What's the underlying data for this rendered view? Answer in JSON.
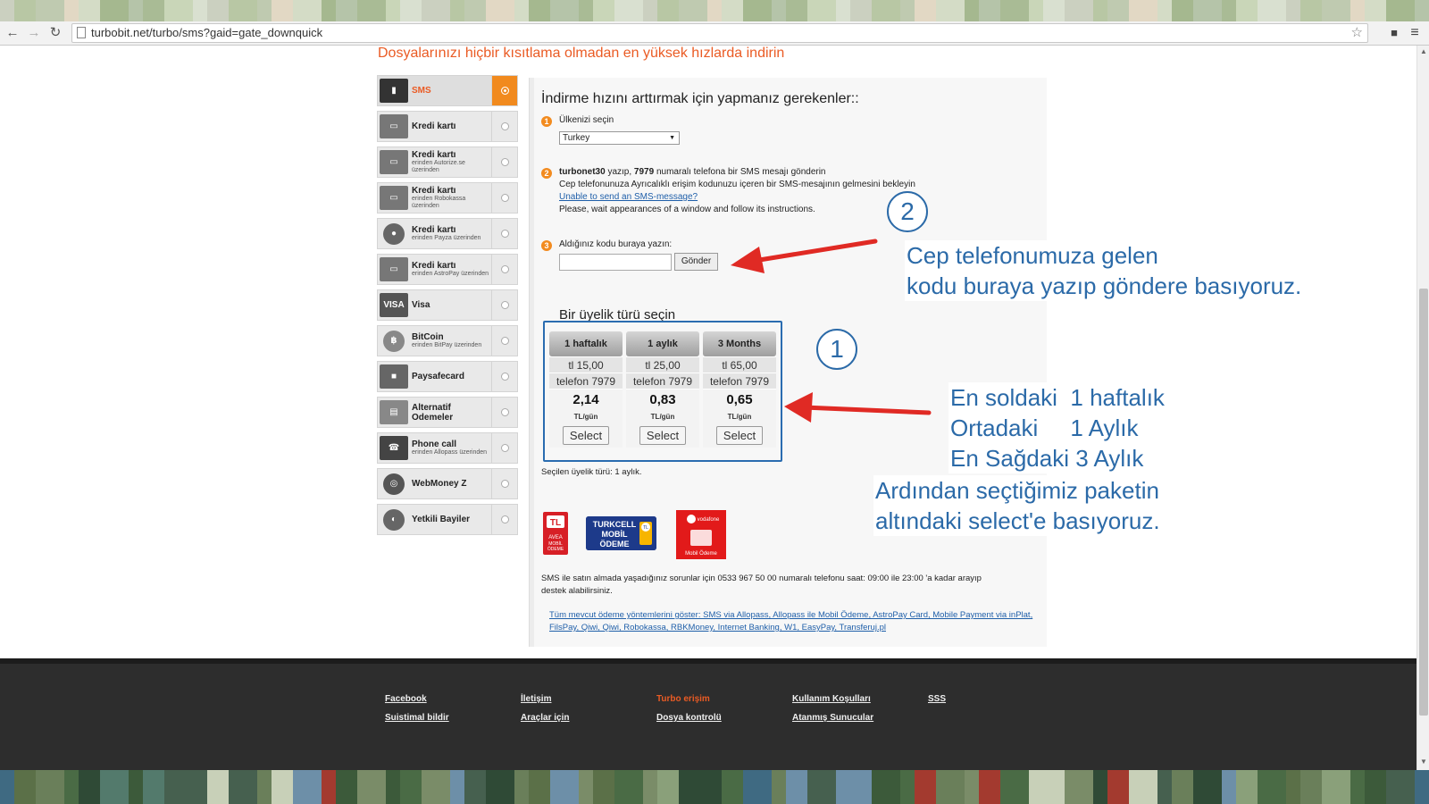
{
  "browser": {
    "url": "turbobit.net/turbo/sms?gaid=gate_downquick",
    "back": "←",
    "forward": "→",
    "reload": "↻",
    "star": "☆",
    "menu": "≡"
  },
  "headline": "Dosyalarınızı hiçbir kısıtlama olmadan en yüksek hızlarda indirin",
  "sidebar": {
    "items": [
      {
        "label": "SMS",
        "sub": "",
        "icon": "phone-icon",
        "active": true
      },
      {
        "label": "Kredi kartı",
        "sub": "",
        "icon": "card-icon",
        "active": false
      },
      {
        "label": "Kredi kartı",
        "sub": "erinden Autorize.se üzerinden",
        "icon": "card-icon",
        "active": false
      },
      {
        "label": "Kredi kartı",
        "sub": "erinden Robokassa üzerinden",
        "icon": "card-icon",
        "active": false
      },
      {
        "label": "Kredi kartı",
        "sub": "erinden Payza üzerinden",
        "icon": "payza-icon",
        "active": false
      },
      {
        "label": "Kredi kartı",
        "sub": "erinden AstroPay üzerinden",
        "icon": "card-icon",
        "active": false
      },
      {
        "label": "Visa",
        "sub": "",
        "icon": "visa-icon",
        "active": false
      },
      {
        "label": "BitCoin",
        "sub": "erinden BitPay üzerinden",
        "icon": "bitcoin-icon",
        "active": false
      },
      {
        "label": "Paysafecard",
        "sub": "",
        "icon": "lock-icon",
        "active": false
      },
      {
        "label": "Alternatif Odemeler",
        "sub": "",
        "icon": "cards-icon",
        "active": false
      },
      {
        "label": "Phone call",
        "sub": "erinden Allopass üzerinden",
        "icon": "fax-icon",
        "active": false
      },
      {
        "label": "WebMoney Z",
        "sub": "",
        "icon": "webmoney-icon",
        "active": false
      },
      {
        "label": "Yetkili Bayiler",
        "sub": "",
        "icon": "globe-icon",
        "active": false
      }
    ]
  },
  "main": {
    "title": "İndirme hızını arttırmak için yapmanız gerekenler::",
    "step1": {
      "num": "1",
      "label": "Ülkenizi seçin",
      "country": "Turkey"
    },
    "step2": {
      "num": "2",
      "line1_bold1": "turbonet30",
      "line1_mid": " yazıp, ",
      "line1_bold2": "7979",
      "line1_end": " numaralı telefona bir SMS mesajı gönderin",
      "line2": "Cep telefonunuza Ayrıcalıklı erişim kodunuzu içeren bir SMS-mesajının gelmesini bekleyin",
      "link": "Unable to send an SMS-message?",
      "line4": "Please, wait appearances of a window and follow its instructions."
    },
    "step3": {
      "num": "3",
      "label": "Aldığınız kodu buraya yazın:",
      "send": "Gönder",
      "code_value": ""
    },
    "plan_title": "Bir üyelik türü seçin",
    "plans": [
      {
        "name": "1 haftalık",
        "price": "tl 15,00",
        "phone": "telefon 7979",
        "per_day": "2,14",
        "unit": "TL/gün",
        "select": "Select"
      },
      {
        "name": "1 aylık",
        "price": "tl 25,00",
        "phone": "telefon 7979",
        "per_day": "0,83",
        "unit": "TL/gün",
        "select": "Select"
      },
      {
        "name": "3 Months",
        "price": "tl 65,00",
        "phone": "telefon 7979",
        "per_day": "0,65",
        "unit": "TL/gün",
        "select": "Select"
      }
    ],
    "selected_plan": "Seçilen üyelik türü: 1 aylık.",
    "logos": {
      "avea": "AVEA MOBİL ÖDEME",
      "turkcell": "TURKCELL MOBİL ÖDEME",
      "vodafone": "vodafone Mobil Ödeme",
      "tl": "TL"
    },
    "support": "SMS ile satın almada yaşadığınız sorunlar için 0533 967 50 00 numaralı telefonu saat: 09:00 ile 23:00 'a kadar arayıp destek alabilirsiniz.",
    "all_methods": "Tüm mevcut ödeme yöntemlerini göster: SMS via Allopass, Allopass ile Mobil Ödeme, AstroPay Card, Mobile Payment via inPlat, FilsPay, Qiwi, Qiwi, Robokassa, RBKMoney, Internet Banking, W1, EasyPay, Transferuj.pl"
  },
  "annotations": {
    "circle1": "1",
    "circle2": "2",
    "note2": "Cep telefonumuza gelen\nkodu buraya yazıp göndere basıyoruz.",
    "note1": "En soldaki  1 haftalık\nOrtadaki     1 Aylık\nEn Sağdaki 3 Aylık",
    "note3": "Ardından seçtiğimiz paketin\naltındaki select'e basıyoruz.",
    "arrow_color": "#e02a24",
    "text_color": "#2b6aa8"
  },
  "footer": {
    "columns": [
      [
        "Facebook",
        "Suistimal bildir"
      ],
      [
        "İletişim",
        "Araçlar için"
      ],
      [
        "Turbo erişim",
        "Dosya kontrolü"
      ],
      [
        "Kullanım Koşulları",
        "Atanmış Sunucular"
      ],
      [
        "SSS"
      ]
    ]
  },
  "colors": {
    "accent": "#ea5b24",
    "link": "#1f5fa9",
    "footer_bg": "#2d2d2d"
  }
}
